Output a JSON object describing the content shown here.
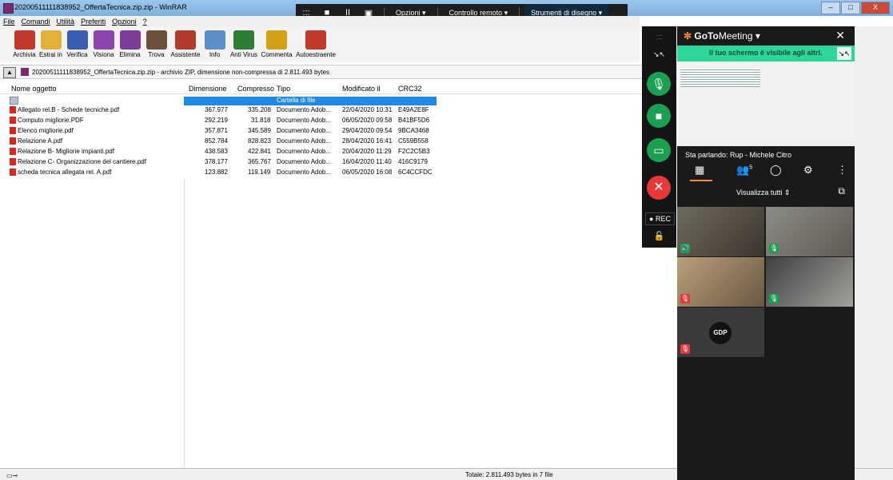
{
  "window": {
    "title": "20200511111838952_OffertaTecnica.zip.zip - WinRAR",
    "controls": [
      "–",
      "□",
      "X"
    ]
  },
  "remote_bar": {
    "icons": [
      ":::",
      "■",
      "II",
      "▣"
    ],
    "labels": [
      "Opzioni ▾",
      "Controllo remoto ▾",
      "Strumenti di disegno ▾"
    ]
  },
  "menu": [
    "File",
    "Comandi",
    "Utilità",
    "Preferiti",
    "Opzioni",
    "?"
  ],
  "toolbar": [
    {
      "label": "Archivia",
      "icon": "books-icon",
      "color": "#c0392b"
    },
    {
      "label": "Estrai in",
      "icon": "folder-extract-icon",
      "color": "#e2b23a"
    },
    {
      "label": "Verifica",
      "icon": "verify-icon",
      "color": "#3a5fb0"
    },
    {
      "label": "Visiona",
      "icon": "view-icon",
      "color": "#8e44ad"
    },
    {
      "label": "Elimina",
      "icon": "delete-icon",
      "color": "#7d3c98"
    },
    {
      "label": "Trova",
      "icon": "binoculars-icon",
      "color": "#6c4f3d"
    },
    {
      "label": "Assistente",
      "icon": "wizard-icon",
      "color": "#b03a2e"
    },
    {
      "label": "Info",
      "icon": "info-icon",
      "color": "#5d8fc7"
    },
    {
      "label": "Anti Virus",
      "icon": "antivirus-icon",
      "color": "#2e7d32"
    },
    {
      "label": "Commenta",
      "icon": "comment-icon",
      "color": "#d4a017"
    },
    {
      "label": "Autoestraente",
      "icon": "sfx-icon",
      "color": "#c0392b"
    }
  ],
  "path": {
    "text": "20200511111838952_OffertaTecnica.zip.zip - archivio ZIP, dimensione non-compressa di 2.811.493 bytes"
  },
  "columns": [
    "Nome oggetto",
    "Dimensione",
    "Compresso",
    "Tipo",
    "Modificato il",
    "CRC32"
  ],
  "folder_row": {
    "name": "..",
    "type": "Cartella di file"
  },
  "files": [
    {
      "name": "Allegato rel.B - Schede tecniche.pdf",
      "size": "367.977",
      "packed": "335.208",
      "type": "Documento Adob...",
      "modified": "22/04/2020 10:31",
      "crc": "E49A2E8F"
    },
    {
      "name": "Computo migliorie.PDF",
      "size": "292.219",
      "packed": "31.818",
      "type": "Documento Adob...",
      "modified": "06/05/2020 09:58",
      "crc": "B41BF5D6"
    },
    {
      "name": "Elenco migliorie.pdf",
      "size": "357.871",
      "packed": "345.589",
      "type": "Documento Adob...",
      "modified": "29/04/2020 09:54",
      "crc": "9BCA3468"
    },
    {
      "name": "Relazione A.pdf",
      "size": "852.784",
      "packed": "828.823",
      "type": "Documento Adob...",
      "modified": "28/04/2020 16:41",
      "crc": "C559B558"
    },
    {
      "name": "Relazione B- Migliorie impianti.pdf",
      "size": "438.583",
      "packed": "422.841",
      "type": "Documento Adob...",
      "modified": "20/04/2020 11:29",
      "crc": "F2C2C5B3"
    },
    {
      "name": "Relazione C- Organizzazione del cantiere.pdf",
      "size": "378.177",
      "packed": "365.767",
      "type": "Documento Adob...",
      "modified": "16/04/2020 11:40",
      "crc": "416C9179"
    },
    {
      "name": "scheda tecnica allegata rel. A.pdf",
      "size": "123.882",
      "packed": "119.149",
      "type": "Documento Adob...",
      "modified": "06/05/2020 16:08",
      "crc": "6C4CCFDC"
    }
  ],
  "status": {
    "total": "Totale: 2.811.493 bytes in 7 file"
  },
  "goto": {
    "brand_a": "GoTo",
    "brand_b": "Meeting ▾",
    "close": "✕",
    "sharing_banner": "Il tuo schermo è visibile agli altri.",
    "speaking": "Sta parlando: Rup - Michele Citro",
    "attendee_count": "5",
    "view_all": "Visualizza tutti ⇕",
    "rec_label": "● REC",
    "participant_initials": "GDP",
    "colors": {
      "green": "#1ba052",
      "red": "#e8393a",
      "accent": "#f68d2e",
      "banner": "#2dd79a"
    }
  }
}
